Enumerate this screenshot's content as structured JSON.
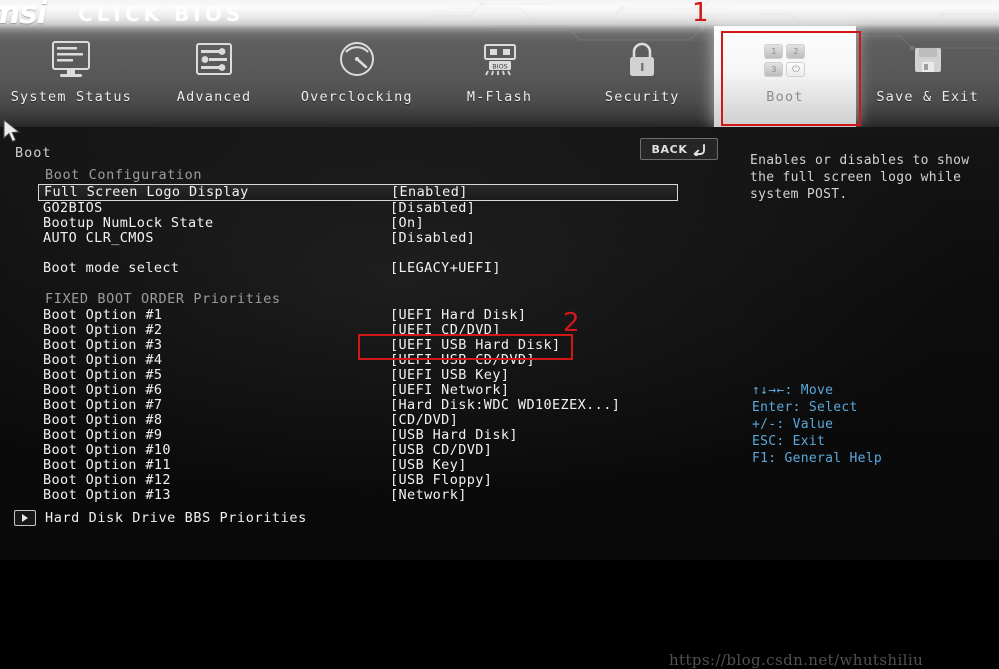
{
  "branding": {
    "logo": "msi",
    "product": "CLICK BIOS"
  },
  "nav": {
    "items": [
      {
        "label": "System Status",
        "icon": "monitor-icon",
        "active": false
      },
      {
        "label": "Advanced",
        "icon": "sliders-icon",
        "active": false
      },
      {
        "label": "Overclocking",
        "icon": "gauge-icon",
        "active": false
      },
      {
        "label": "M-Flash",
        "icon": "usb-bios-icon",
        "active": false
      },
      {
        "label": "Security",
        "icon": "padlock-icon",
        "active": false
      },
      {
        "label": "Boot",
        "icon": "boot-keys-icon",
        "active": true
      },
      {
        "label": "Save & Exit",
        "icon": "floppy-disk-icon",
        "active": false
      }
    ],
    "boot_icon_keys": [
      "1",
      "2",
      "3",
      "⏻"
    ]
  },
  "page": {
    "title": "Boot",
    "back_label": "BACK",
    "back_icon": "return-arrow-icon"
  },
  "sections": {
    "boot_configuration": {
      "heading": "Boot Configuration",
      "rows": [
        {
          "label": "Full Screen Logo Display",
          "value": "[Enabled]",
          "selected": true
        },
        {
          "label": "GO2BIOS",
          "value": "[Disabled]",
          "selected": false
        },
        {
          "label": "Bootup NumLock State",
          "value": "[On]",
          "selected": false
        },
        {
          "label": "AUTO CLR_CMOS",
          "value": "[Disabled]",
          "selected": false
        }
      ]
    },
    "boot_mode": {
      "rows": [
        {
          "label": "Boot mode select",
          "value": "[LEGACY+UEFI]",
          "selected": false
        }
      ]
    },
    "fixed_boot_order": {
      "heading": "FIXED BOOT ORDER Priorities",
      "rows": [
        {
          "label": "Boot Option #1",
          "value": "[UEFI Hard Disk]",
          "selected": false
        },
        {
          "label": "Boot Option #2",
          "value": "[UEFI CD/DVD]",
          "selected": false
        },
        {
          "label": "Boot Option #3",
          "value": "[UEFI USB Hard Disk]",
          "selected": false
        },
        {
          "label": "Boot Option #4",
          "value": "[UEFI USB CD/DVD]",
          "selected": false
        },
        {
          "label": "Boot Option #5",
          "value": "[UEFI USB Key]",
          "selected": false
        },
        {
          "label": "Boot Option #6",
          "value": "[UEFI Network]",
          "selected": false
        },
        {
          "label": "Boot Option #7",
          "value": "[Hard Disk:WDC WD10EZEX...]",
          "selected": false
        },
        {
          "label": "Boot Option #8",
          "value": "[CD/DVD]",
          "selected": false
        },
        {
          "label": "Boot Option #9",
          "value": "[USB Hard Disk]",
          "selected": false
        },
        {
          "label": "Boot Option #10",
          "value": "[USB CD/DVD]",
          "selected": false
        },
        {
          "label": "Boot Option #11",
          "value": "[USB Key]",
          "selected": false
        },
        {
          "label": "Boot Option #12",
          "value": "[USB Floppy]",
          "selected": false
        },
        {
          "label": "Boot Option #13",
          "value": "[Network]",
          "selected": false
        }
      ]
    },
    "submenu": {
      "label": "Hard Disk Drive BBS Priorities",
      "icon": "right-arrow-icon"
    }
  },
  "help": {
    "text": "Enables or disables to show the full screen logo while system POST."
  },
  "key_legend": {
    "color": "#5aa8dd",
    "lines": [
      "↑↓→←: Move",
      "Enter: Select",
      "+/-: Value",
      "ESC: Exit",
      "F1: General Help"
    ]
  },
  "annotations": {
    "color": "#d01818",
    "items": [
      {
        "number": "1",
        "target": "Boot tab in top navigation"
      },
      {
        "number": "2",
        "target": "Boot Option #3 value [UEFI USB Hard Disk]"
      }
    ]
  },
  "watermark": {
    "text": "https://blog.csdn.net/whutshiliu"
  }
}
